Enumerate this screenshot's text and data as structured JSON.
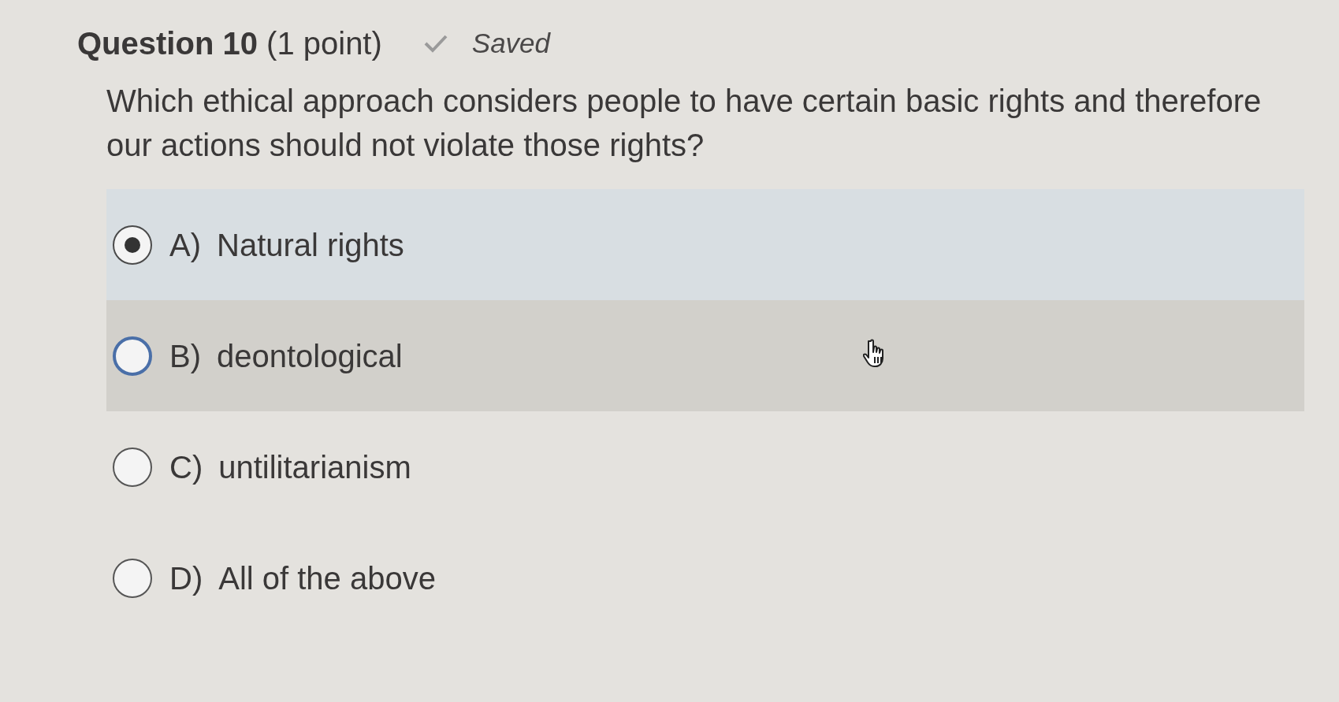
{
  "question": {
    "title": "**Question 10** (1 point)",
    "status": "Saved",
    "saved": true,
    "text": "Which ethical approach considers people to have certain basic rights and therefore our actions should not violate those rights?"
  },
  "options": [
    {
      "letter": "A)",
      "label": "Natural rights",
      "selected": true,
      "hovered": false
    },
    {
      "letter": "B)",
      "label": "deontological",
      "selected": false,
      "hovered": true
    },
    {
      "letter": "C)",
      "label": "untilitarianism",
      "selected": false,
      "hovered": false
    },
    {
      "letter": "D)",
      "label": "All of the above",
      "selected": false,
      "hovered": false
    }
  ]
}
